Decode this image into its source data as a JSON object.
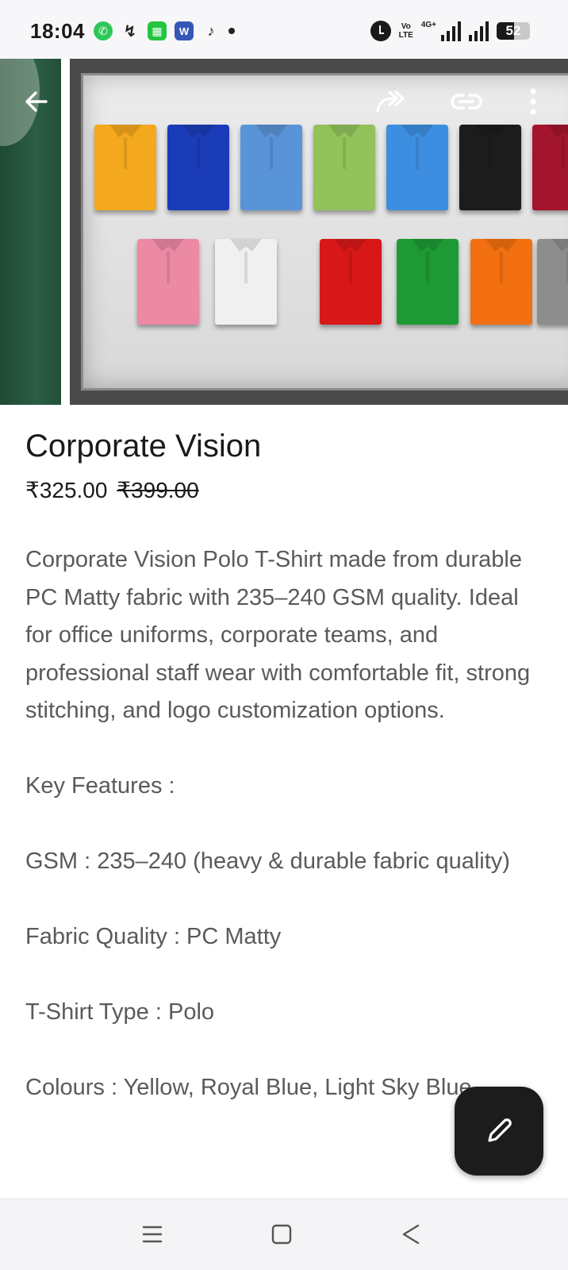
{
  "status_bar": {
    "time": "18:04",
    "left_icons": [
      "whatsapp-icon",
      "missed-call-icon",
      "green-app-icon",
      "word-app-icon",
      "script-app-icon",
      "notification-dot"
    ],
    "volte_label_top": "Vo",
    "volte_label_bottom": "LTE",
    "network_label": "4G+",
    "battery_level": "52",
    "battery_fraction": 0.52
  },
  "hero": {
    "back_icon": "back-arrow-icon",
    "share_icon": "share-icon",
    "link_icon": "link-icon",
    "menu_icon": "more-vertical-icon",
    "shirt_colors_row1": [
      "#f4a81e",
      "#1b3cb8",
      "#5a94d8",
      "#92c25a",
      "#3d8ee0",
      "#1c1c1c",
      "#a3152c"
    ],
    "shirt_colors_row2": [
      "#ec8aa5",
      "#f0f0f0",
      "#d81818",
      "#1e9a35",
      "#f2700f",
      "#8d8d8d"
    ]
  },
  "product": {
    "title": "Corporate Vision",
    "price": "₹325.00",
    "original_price": "₹399.00",
    "description": "Corporate Vision Polo T-Shirt made from durable PC Matty fabric with 235–240 GSM quality. Ideal for office uniforms, corporate teams, and professional staff wear with comfortable fit, strong stitching, and logo customization options.",
    "key_features_heading": "Key Features :",
    "features": [
      "GSM : 235–240 (heavy & durable fabric quality)",
      "Fabric Quality : PC Matty",
      "T-Shirt Type : Polo",
      "Colours : Yellow, Royal Blue, Light Sky Blue,"
    ]
  },
  "fab": {
    "icon": "edit-pencil-icon"
  },
  "nav_bar": {
    "recents_icon": "recents-menu-icon",
    "home_icon": "home-square-icon",
    "back_icon": "back-triangle-icon"
  },
  "colors": {
    "fab_background": "#1c1c1c",
    "text_primary": "#1a1a1a",
    "text_secondary": "#5a5a5a"
  }
}
